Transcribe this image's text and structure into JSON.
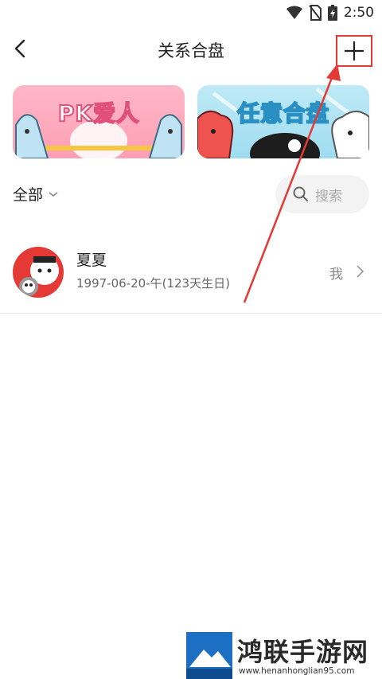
{
  "status_bar": {
    "time": "2:50",
    "icons": [
      "wifi-icon",
      "no-sim-icon",
      "battery-charging-icon"
    ]
  },
  "header": {
    "title": "关系合盘",
    "back_icon": "back-chevron-icon",
    "add_icon": "plus-icon"
  },
  "banners": [
    {
      "text": "PK爱人",
      "color": "#ff9fb4"
    },
    {
      "text": "任意合盘",
      "color": "#9fdcf0"
    }
  ],
  "filter": {
    "selected": "全部",
    "search_placeholder": "搜索"
  },
  "list": [
    {
      "name": "夏夏",
      "birth": "1997-06-20-午(123天生日)",
      "relation": "我"
    }
  ],
  "watermark": {
    "name": "鸿联手游网",
    "url": "www.henanhonglian95.com"
  },
  "colors": {
    "annotation_red": "#e53935",
    "avatar_bg": "#e53935"
  }
}
